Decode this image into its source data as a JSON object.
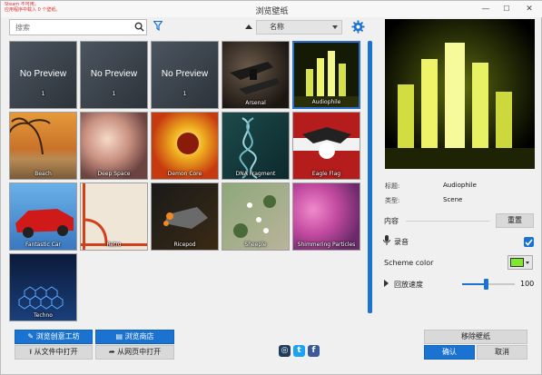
{
  "window": {
    "title": "浏览壁纸",
    "warning_lines": [
      "Steam 不可用。",
      "应用程序中载入 0 个壁纸。"
    ],
    "minimize": "—",
    "maximize": "☐",
    "close": "✕"
  },
  "toolbar": {
    "search_placeholder": "搜索",
    "sort_label": "名称"
  },
  "tiles": [
    {
      "label": "1",
      "no_preview": "No Preview"
    },
    {
      "label": "1",
      "no_preview": "No Preview"
    },
    {
      "label": "1",
      "no_preview": "No Preview"
    },
    {
      "label": "Arsenal",
      "no_preview": ""
    },
    {
      "label": "Audiophile",
      "no_preview": ""
    },
    {
      "label": "Beach",
      "no_preview": ""
    },
    {
      "label": "Deep Space",
      "no_preview": ""
    },
    {
      "label": "Demon Core",
      "no_preview": ""
    },
    {
      "label": "DNA Fragment",
      "no_preview": ""
    },
    {
      "label": "Eagle Flag",
      "no_preview": ""
    },
    {
      "label": "Fantastic Car",
      "no_preview": ""
    },
    {
      "label": "Retro",
      "no_preview": ""
    },
    {
      "label": "Ricepod",
      "no_preview": ""
    },
    {
      "label": "Sheeple",
      "no_preview": ""
    },
    {
      "label": "Shimmering Particles",
      "no_preview": ""
    },
    {
      "label": "Techno",
      "no_preview": ""
    }
  ],
  "selected_tile": "Audiophile",
  "details": {
    "title_label": "标题:",
    "title_value": "Audiophile",
    "type_label": "类型:",
    "type_value": "Scene"
  },
  "settings": {
    "content_label": "内容",
    "reset_button": "重置",
    "audio_label": "录音",
    "audio_checked": true,
    "scheme_label": "Scheme color",
    "scheme_color": "#7ee82a",
    "playback_label": "回放速度",
    "playback_value": "100",
    "playback_fraction": 0.45
  },
  "buttons": {
    "workshop": "浏览创意工坊",
    "store": "浏览商店",
    "open_file": "从文件中打开",
    "open_web": "从网页中打开",
    "remove": "移除壁纸",
    "ok": "确认",
    "cancel": "取消"
  },
  "colors": {
    "accent": "#1a73d1"
  }
}
